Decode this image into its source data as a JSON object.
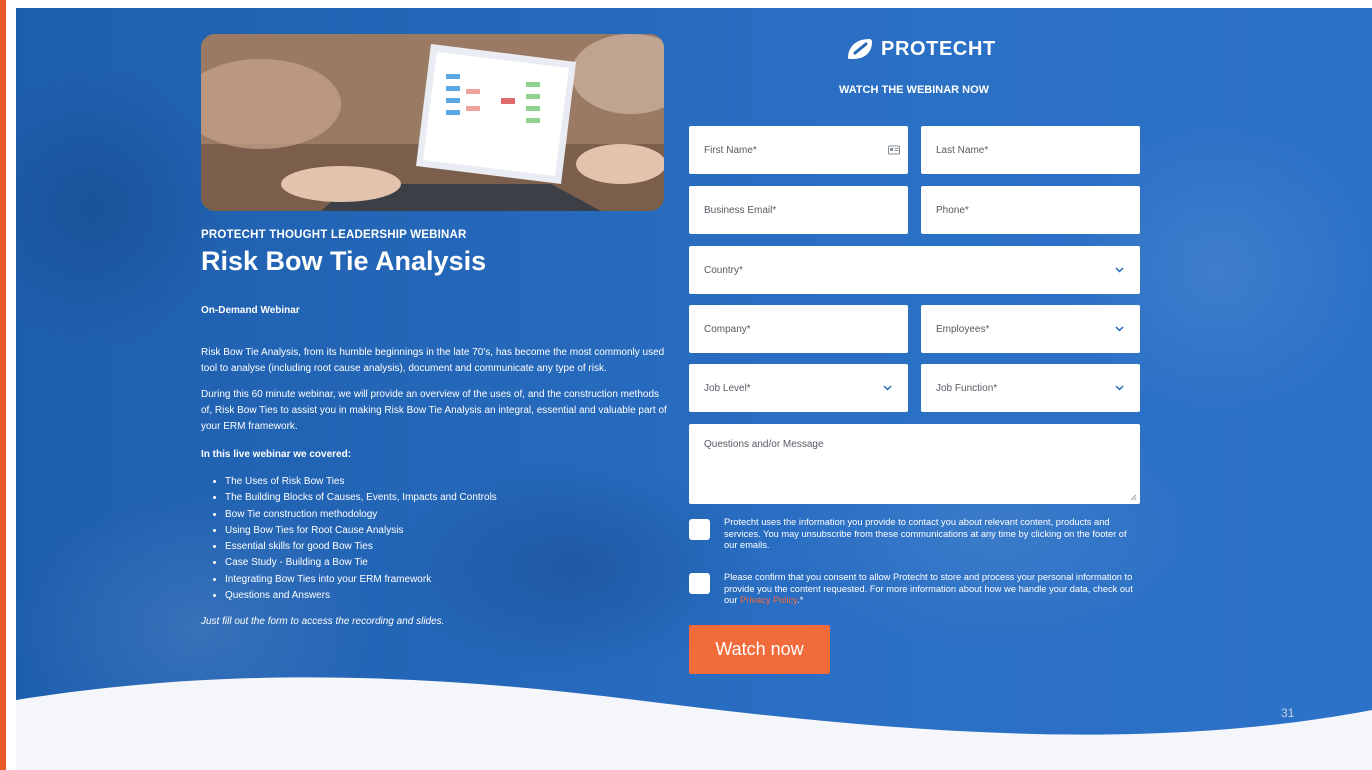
{
  "slide": {
    "number": "31"
  },
  "webinar": {
    "kicker": "PROTECHT THOUGHT LEADERSHIP WEBINAR",
    "title": "Risk Bow Tie Analysis",
    "subtitle": "On-Demand Webinar",
    "para1": "Risk Bow Tie Analysis, from its humble beginnings in the late 70's, has become the most commonly used tool to analyse (including root cause analysis), document and communicate any type of risk.",
    "para2": "During this 60 minute webinar, we will provide an overview of the uses of, and the construction methods of, Risk Bow Ties to assist you in making Risk Bow Tie Analysis an integral, essential and valuable part of your ERM framework.",
    "covered_heading": "In this live webinar we covered:",
    "topics": [
      "The Uses of Risk Bow Ties",
      "The Building Blocks of Causes, Events, Impacts and Controls",
      "Bow Tie construction methodology",
      "Using Bow Ties for Root Cause Analysis",
      "Essential skills for good Bow Ties",
      "Case Study - Building a Bow Tie",
      "Integrating Bow Ties into your ERM framework",
      "Questions and Answers"
    ],
    "closing": "Just fill out the form to access the recording and slides."
  },
  "brand": {
    "logo_text": "PROTECHT",
    "accent": "#f26b3a",
    "background": "#2466b7"
  },
  "form": {
    "heading": "WATCH THE WEBINAR NOW",
    "first_name": "First Name*",
    "last_name": "Last Name*",
    "email": "Business Email*",
    "phone": "Phone*",
    "country": "Country*",
    "company": "Company*",
    "employees": "Employees*",
    "job_level": "Job Level*",
    "job_function": "Job Function*",
    "message": "Questions and/or Message",
    "consent1": "Protecht uses the information you provide to contact you about relevant content, products and services. You may unsubscribe from these communications at any time by clicking on the footer of our emails.",
    "consent2_text": "Please confirm that you consent to allow Protecht to store and process your personal information to provide you the content requested. For more information about how we handle your data, check out our ",
    "consent2_link": "Privacy Policy",
    "consent2_suffix": ".*",
    "submit": "Watch now"
  }
}
